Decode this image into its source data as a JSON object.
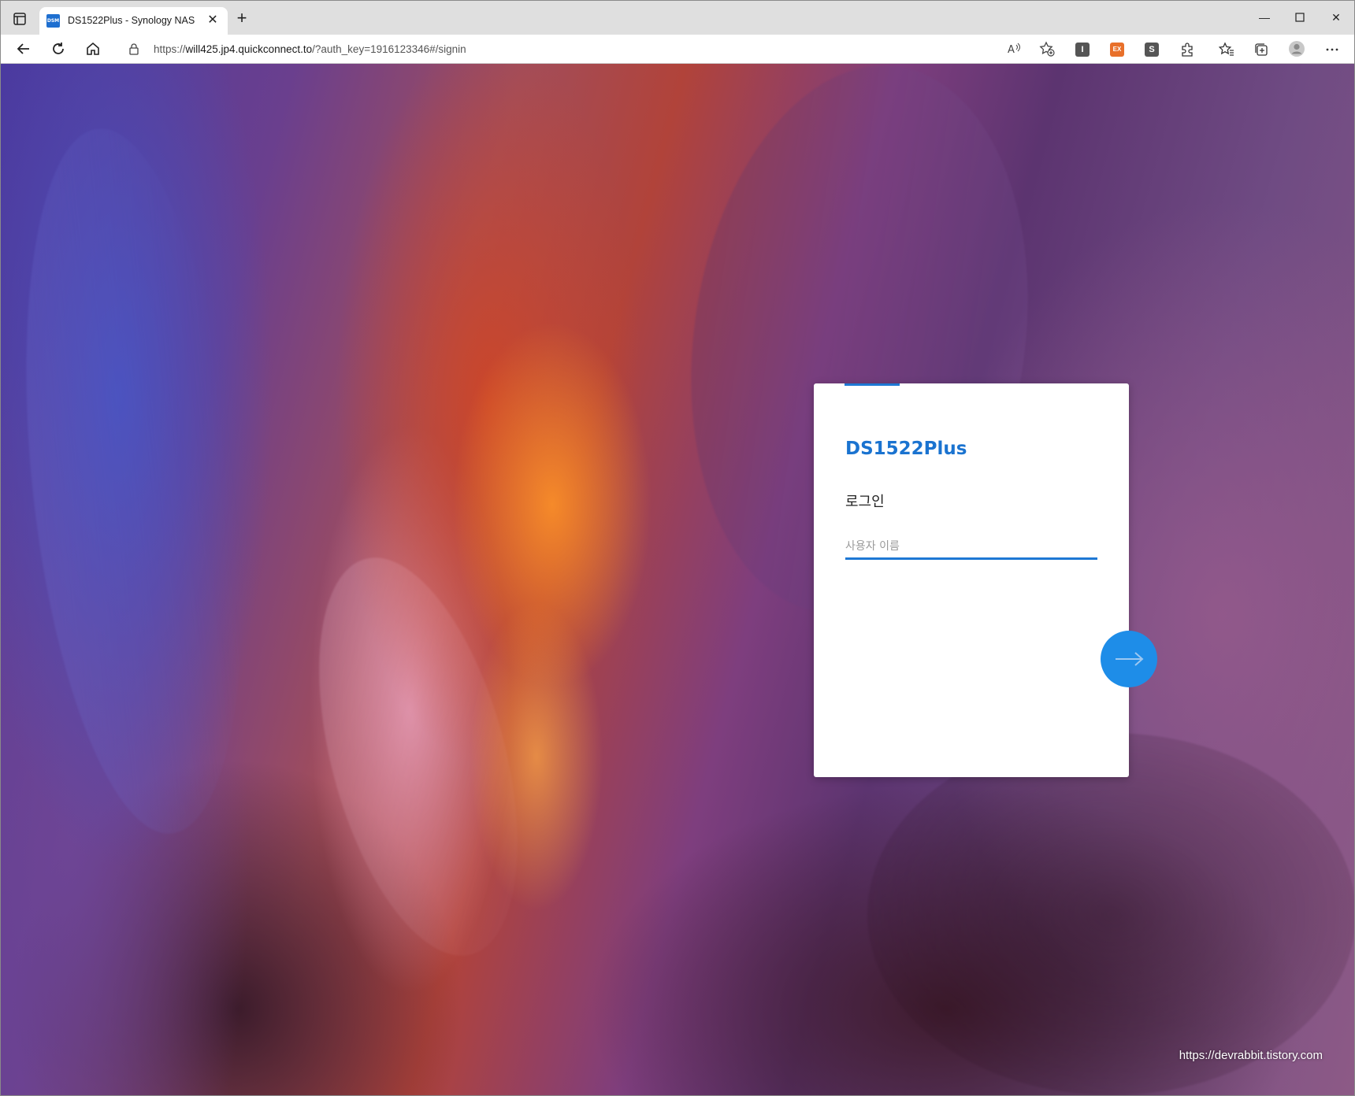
{
  "browser": {
    "tab_title": "DS1522Plus - Synology NAS",
    "favicon_text": "DSM",
    "url_prefix": "https://",
    "url_host": "will425.jp4.quickconnect.to",
    "url_path": "/?auth_key=1916123346#/signin",
    "extensions": [
      {
        "label": "I",
        "color": "#555555"
      },
      {
        "label": "EX",
        "color": "#e8702a"
      },
      {
        "label": "S",
        "color": "#555555"
      }
    ]
  },
  "login": {
    "server_name": "DS1522Plus",
    "title": "로그인",
    "username_placeholder": "사용자 이름",
    "username_value": ""
  },
  "watermark": "https://devrabbit.tistory.com",
  "colors": {
    "accent": "#1e78d4",
    "button": "#1e8de8"
  }
}
